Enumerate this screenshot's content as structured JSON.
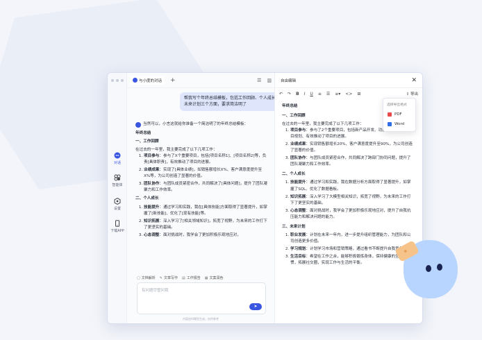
{
  "chat": {
    "tab_label": "与小度的对话",
    "user_message": "帮我写个年终总结模板，包括工作回顾、个人成长、未来计划三个方面，要求简洁明了",
    "intro": "当然可以，小言这就给你准备一个简洁明了的年终总结模板：",
    "title": "年终总结",
    "section1": "一、工作回顾",
    "lead": "在过去的一年里，我主要完成了以下几项工作：",
    "items1": [
      {
        "label": "项目参与",
        "text": "：参与了X个重要项目，包括[项目名称1]、[项目名称2]等，负责[具体职责]，有效推动了项目的进展。"
      },
      {
        "label": "业绩成果",
        "text": "：实现了[具体业绩]，如销售额增长X%、客户满意度提升至X%等，为公司创造了显著的价值。"
      },
      {
        "label": "团队协作",
        "text": "：与团队成员紧密合作，共同解决了[具体问题]，提升了团队凝聚力和工作效率。"
      }
    ],
    "section2": "二、个人成长",
    "items2": [
      {
        "label": "技能提升",
        "text": "：通过学习和实践，我在[具体技能]方面取得了显著提升，如掌握了[新技能]、优化了[现有技能]等。"
      },
      {
        "label": "知识拓展",
        "text": "：深入学习了[相关领域知识]，拓宽了视野，为未来的工作打下了更坚实的基础。"
      },
      {
        "label": "心态调整",
        "text": "：面对挑战时，我学会了更加积极乐观地应对，"
      }
    ],
    "tools": [
      "文档解析",
      "文章写作",
      "工作报告",
      "文案润色"
    ],
    "input_placeholder": "有问题尽管问我",
    "send_label": "➤",
    "footer": "内容由AI模型生成，仅供参考"
  },
  "rail": {
    "items": [
      {
        "label": "对话",
        "icon": "chat-icon"
      },
      {
        "label": "智能体",
        "icon": "agent-icon"
      },
      {
        "label": "设置",
        "icon": "settings-icon"
      },
      {
        "label": "下载APP",
        "icon": "phone-icon"
      }
    ]
  },
  "editor": {
    "header": "自由编辑",
    "close": "✕",
    "tools": [
      "↶",
      "↷",
      "B",
      "I",
      "U",
      "≡",
      "☰",
      "≡▾",
      "<>",
      "⊞"
    ],
    "export_label": "⇪ 导出",
    "export_menu": {
      "title": "选择导出格式",
      "options": [
        "PDF",
        "Word"
      ]
    },
    "doc": {
      "title": "年终总结",
      "section1": "一、工作回顾",
      "lead": "在过去的一年里，我主要完成了以下几项工作：",
      "items1": [
        {
          "label": "项目参与",
          "text": "：参与了2个重要项目，包括新产品开发、功能迭代等，负责项目规划、有效推动了项目的进展。"
        },
        {
          "label": "业绩成果",
          "text": "：实现销售额增长20%、客户满意度提升至90%，为公司创造了显著的价值。"
        },
        {
          "label": "团队协作",
          "text": "：与团队成员紧密合作，共同解决了跨部门协同问题，提升了团队凝聚力和工作效率。"
        }
      ],
      "section2": "二、个人成长",
      "items2": [
        {
          "label": "技能提升",
          "text": "：通过学习和实践，我在数据分析方面取得了显著提升，如掌握了SQL、优化了数据看板。"
        },
        {
          "label": "知识拓展",
          "text": "：深入学习了大模型相关知识，拓宽了视野，为未来的工作打下了更坚实的基础。"
        },
        {
          "label": "心态调整",
          "text": "：面对挑战时，我学会了更加积极乐观地应对，提升了自我抗压能力和解决问题的能力。"
        }
      ],
      "section3": "三、未来计划",
      "items3": [
        {
          "label": "职业发展",
          "text": "：计划在未来一年内，进一步提升组织管理能力，为团队和公司创造更多价值。"
        },
        {
          "label": "学习规划",
          "text": "：计划学习市场和营销策略，通过看书不断提升自我竞争力。"
        },
        {
          "label": "生活目标",
          "text": "：希望在工作之余，能够积极锻炼身体，保持健康的生活习惯，拓展社交圈，实现工作与生活的平衡。"
        }
      ]
    }
  },
  "colors": {
    "accent": "#3a56e0",
    "bubble": "#dfe6fb",
    "mascot": "#b8d5ff"
  }
}
